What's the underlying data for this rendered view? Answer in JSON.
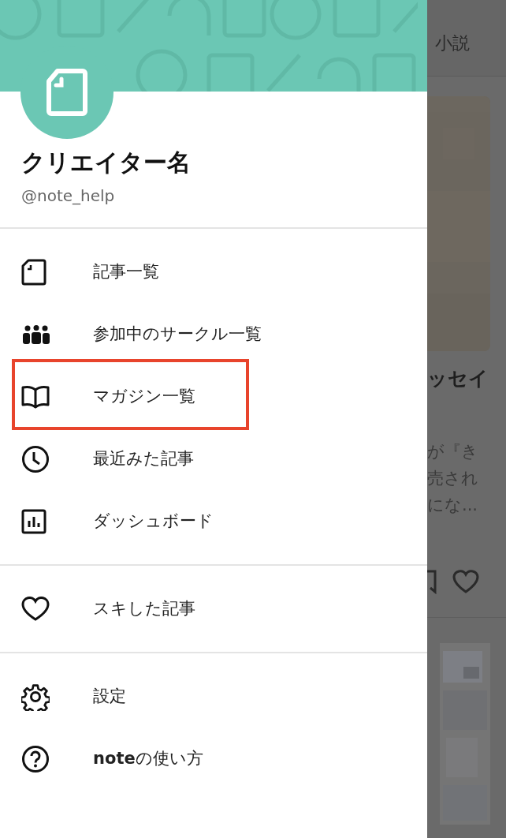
{
  "drawer": {
    "creator_name": "クリエイター名",
    "handle": "@note_help",
    "sections": [
      {
        "items": [
          {
            "kind": "document",
            "label": "記事一覧",
            "highlighted": false
          },
          {
            "kind": "people",
            "label": "参加中のサークル一覧",
            "highlighted": false
          },
          {
            "kind": "book",
            "label": "マガジン一覧",
            "highlighted": true
          },
          {
            "kind": "clock",
            "label": "最近みた記事",
            "highlighted": false
          },
          {
            "kind": "chart",
            "label": "ダッシュボード",
            "highlighted": false
          }
        ]
      },
      {
        "items": [
          {
            "kind": "heart",
            "label": "スキした記事",
            "highlighted": false
          }
        ]
      },
      {
        "items": [
          {
            "kind": "gear",
            "label": "設定",
            "highlighted": false
          },
          {
            "kind": "help",
            "label": "**note**の使い方",
            "highlighted": false
          }
        ]
      }
    ]
  },
  "background_page": {
    "tab": "小説",
    "card_title": "ッセイ",
    "card_excerpt_lines": [
      "が『き",
      "売され",
      "にな..."
    ]
  }
}
